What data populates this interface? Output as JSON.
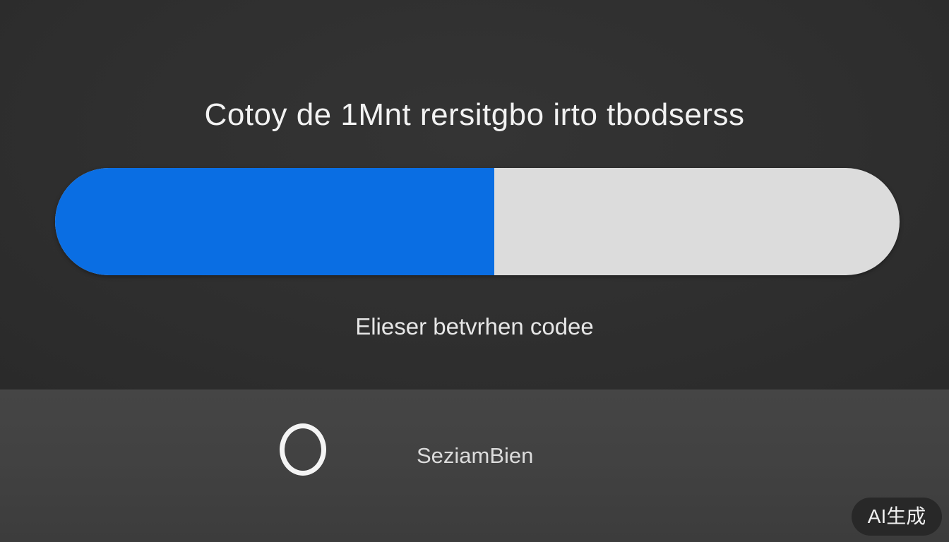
{
  "dialog": {
    "title": "Cotoy de 1Mnt rersitgbo irto tbodserss",
    "status_text": "Elieser betvrhen codee"
  },
  "progress": {
    "fraction": 0.52,
    "fill_color": "#0a6ee3",
    "track_color": "#dcdcdc"
  },
  "footer": {
    "spinner_icon": "loading-ring-icon",
    "label": "SeziamBien"
  },
  "watermark": {
    "label": "AI生成"
  }
}
